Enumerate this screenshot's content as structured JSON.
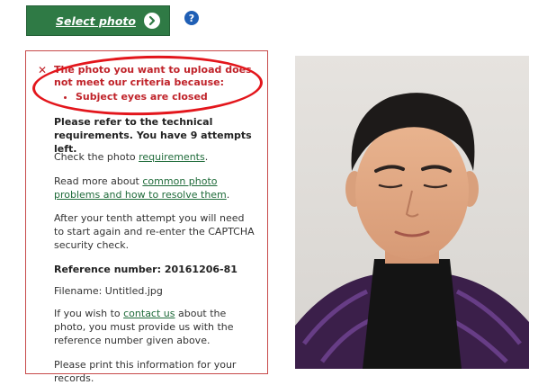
{
  "select_button": {
    "label": "Select photo",
    "icon": "chevron-right-icon"
  },
  "help": {
    "icon": "help-icon",
    "glyph": "?"
  },
  "error": {
    "icon": "close-x-icon",
    "glyph": "✕",
    "message": "The photo you want to upload does not meet our criteria because:",
    "reasons": [
      "Subject eyes are closed"
    ]
  },
  "info": {
    "refer": "Please refer to the technical requirements. You have 9 attempts left.",
    "check_prefix": "Check the photo ",
    "check_link": "requirements",
    "check_suffix": ".",
    "readmore_prefix": "Read more about ",
    "readmore_link": "common photo problems and how to resolve them",
    "readmore_suffix": ".",
    "tenth": "After your tenth attempt you will need to start again and re-enter the CAPTCHA security check.",
    "reference": "Reference number: 20161206-81",
    "filename": "Filename: Untitled.jpg",
    "contact_prefix": "If you wish to ",
    "contact_link": "contact us",
    "contact_suffix": " about the photo, you must provide us with the reference number given above.",
    "print": "Please print this information for your records."
  },
  "colors": {
    "button_green": "#2f7a45",
    "error_red": "#c0232a",
    "link_green": "#1f6b3a",
    "annotation_red": "#e3161c"
  }
}
